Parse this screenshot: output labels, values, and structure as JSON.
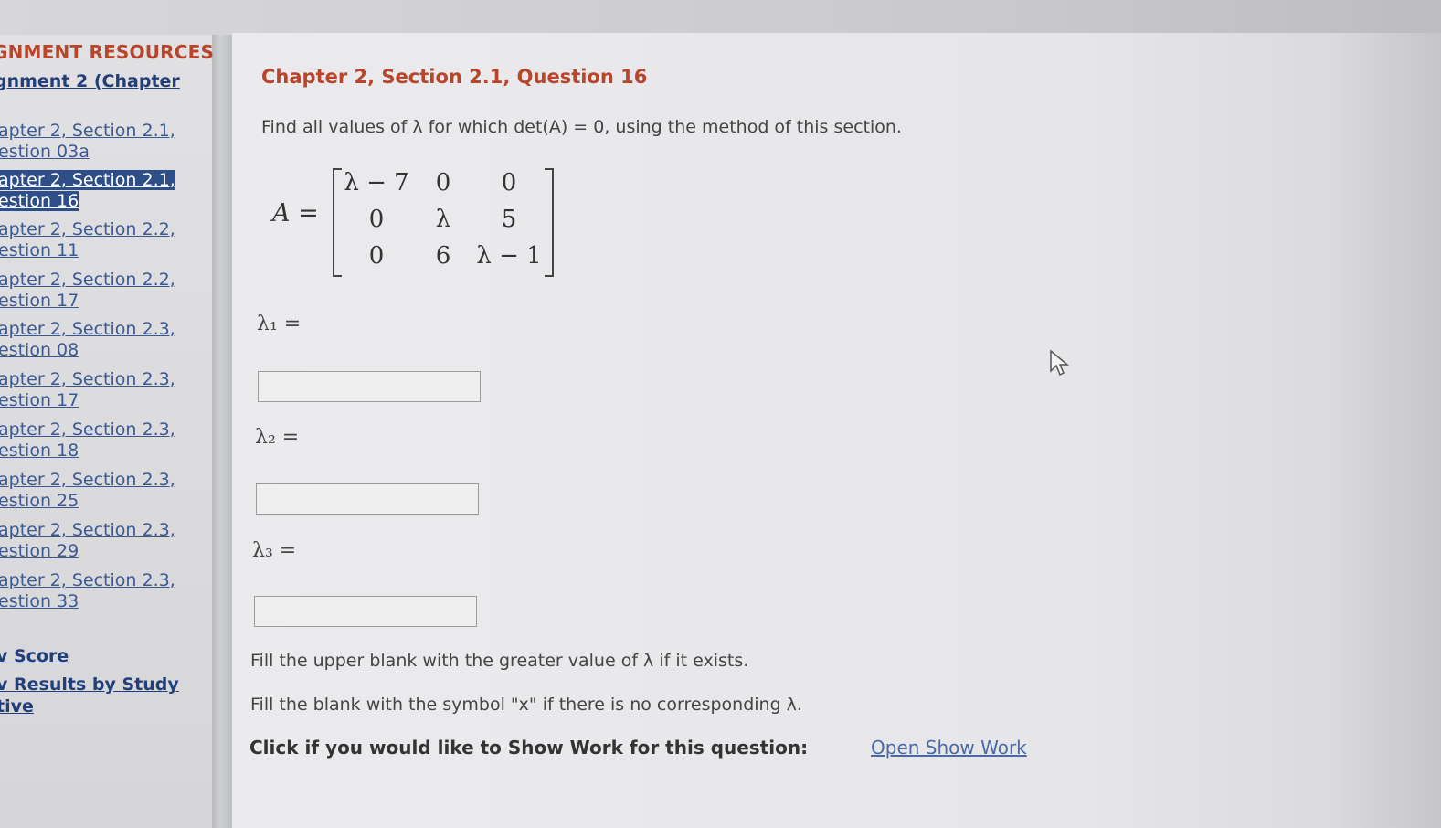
{
  "sidebar": {
    "header": "GNMENT RESOURCES",
    "assignment_link": "gnment 2 (Chapter",
    "items": [
      {
        "line1": "apter 2, Section 2.1,",
        "line2": "estion 03a",
        "active": false
      },
      {
        "line1": "apter 2, Section 2.1,",
        "line2": "estion 16",
        "active": true
      },
      {
        "line1": "apter 2, Section 2.2,",
        "line2": "estion 11",
        "active": false
      },
      {
        "line1": "apter 2, Section 2.2,",
        "line2": "estion 17",
        "active": false
      },
      {
        "line1": "apter 2, Section 2.3,",
        "line2": "estion 08",
        "active": false
      },
      {
        "line1": "apter 2, Section 2.3,",
        "line2": "estion 17",
        "active": false
      },
      {
        "line1": "apter 2, Section 2.3,",
        "line2": "estion 18",
        "active": false
      },
      {
        "line1": "apter 2, Section 2.3,",
        "line2": "estion 25",
        "active": false
      },
      {
        "line1": "apter 2, Section 2.3,",
        "line2": "estion 29",
        "active": false
      },
      {
        "line1": "apter 2, Section 2.3,",
        "line2": "estion 33",
        "active": false
      }
    ],
    "view_score": "v Score",
    "view_results_line1": "v Results by Study",
    "view_results_line2": "tive"
  },
  "question": {
    "title": "Chapter 2, Section 2.1, Question 16",
    "instruction": "Find all values of λ for which det(A) = 0, using the method of this section.",
    "matrix_label": "A =",
    "matrix": [
      [
        "λ − 7",
        "0",
        "0"
      ],
      [
        "0",
        "λ",
        "5"
      ],
      [
        "0",
        "6",
        "λ − 1"
      ]
    ],
    "answers": [
      {
        "label": "λ₁ =",
        "value": ""
      },
      {
        "label": "λ₂ =",
        "value": ""
      },
      {
        "label": "λ₃ =",
        "value": ""
      }
    ],
    "note1": "Fill the upper blank with the greater value of λ if it exists.",
    "note2": "Fill the blank with the symbol \"x\" if there is no corresponding λ.",
    "show_work_prompt": "Click if you would like to Show Work for this question:",
    "show_work_link": "Open Show Work"
  },
  "colors": {
    "accent_red": "#b9452b",
    "link_blue": "#3b5a93",
    "active_bg": "#2d4e86"
  },
  "icons": {
    "cursor": "pointer-arrow-icon"
  }
}
